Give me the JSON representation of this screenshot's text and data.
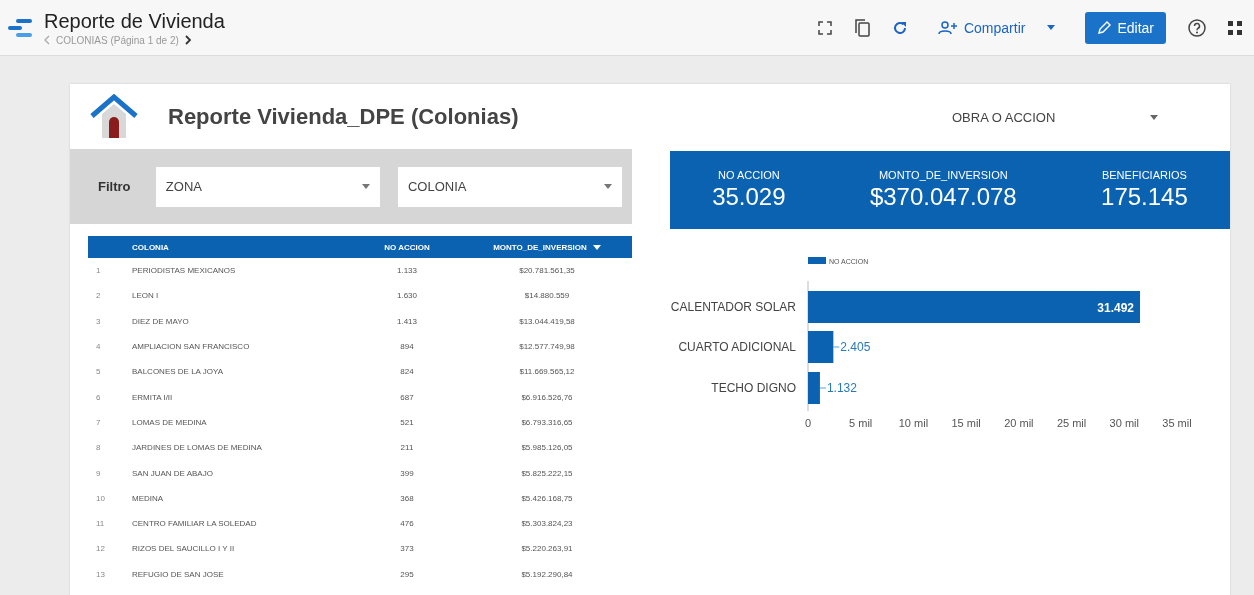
{
  "header": {
    "title": "Reporte de Vivienda",
    "page_nav": "COLONIAS (Página 1 de 2)",
    "share_button": "Compartir",
    "edit_button": "Editar"
  },
  "report": {
    "title": "Reporte Vivienda_DPE (Colonias)",
    "filter": {
      "label": "Filtro",
      "dropdowns": [
        "ZONA",
        "COLONIA"
      ]
    },
    "action_dropdown": "OBRA O ACCION",
    "kpis": [
      {
        "label": "NO ACCION",
        "value": "35.029"
      },
      {
        "label": "MONTO_DE_INVERSION",
        "value": "$370.047.078"
      },
      {
        "label": "BENEFICIARIOS",
        "value": "175.145"
      }
    ],
    "table": {
      "columns": [
        "COLONIA",
        "NO ACCION",
        "MONTO_DE_INVERSION"
      ],
      "rows": [
        {
          "index": "1",
          "colonia": "PERIODISTAS MEXICANOS",
          "no_accion": "1.133",
          "monto": "$20.781.561,35"
        },
        {
          "index": "2",
          "colonia": "LEON I",
          "no_accion": "1.630",
          "monto": "$14.880.559"
        },
        {
          "index": "3",
          "colonia": "DIEZ DE MAYO",
          "no_accion": "1.413",
          "monto": "$13.044.419,58"
        },
        {
          "index": "4",
          "colonia": "AMPLIACION SAN FRANCISCO",
          "no_accion": "894",
          "monto": "$12.577.749,98"
        },
        {
          "index": "5",
          "colonia": "BALCONES DE LA JOYA",
          "no_accion": "824",
          "monto": "$11.669.565,12"
        },
        {
          "index": "6",
          "colonia": "ERMITA I/II",
          "no_accion": "687",
          "monto": "$6.916.526,76"
        },
        {
          "index": "7",
          "colonia": "LOMAS DE MEDINA",
          "no_accion": "521",
          "monto": "$6.793.316,65"
        },
        {
          "index": "8",
          "colonia": "JARDINES DE LOMAS DE MEDINA",
          "no_accion": "211",
          "monto": "$5.985.126,05"
        },
        {
          "index": "9",
          "colonia": "SAN JUAN DE ABAJO",
          "no_accion": "399",
          "monto": "$5.825.222,15"
        },
        {
          "index": "10",
          "colonia": "MEDINA",
          "no_accion": "368",
          "monto": "$5.426.168,75"
        },
        {
          "index": "11",
          "colonia": "CENTRO FAMILIAR LA SOLEDAD",
          "no_accion": "476",
          "monto": "$5.303.824,23"
        },
        {
          "index": "12",
          "colonia": "RIZOS DEL SAUCILLO I Y II",
          "no_accion": "373",
          "monto": "$5.220.263,91"
        },
        {
          "index": "13",
          "colonia": "REFUGIO DE SAN JOSE",
          "no_accion": "295",
          "monto": "$5.192.290,84"
        }
      ]
    },
    "chart_data": {
      "type": "bar",
      "orientation": "horizontal",
      "categories": [
        "CALENTADOR SOLAR",
        "CUARTO ADICIONAL",
        "TECHO DIGNO"
      ],
      "series": [
        {
          "name": "NO ACCION",
          "color": "#0b62b0",
          "values": [
            31.492,
            2.405,
            1.132
          ]
        }
      ],
      "xlim": [
        0,
        35
      ],
      "xticks": [
        {
          "value": 0,
          "label": "0"
        },
        {
          "value": 5,
          "label": "5 mil"
        },
        {
          "value": 10,
          "label": "10 mil"
        },
        {
          "value": 15,
          "label": "15 mil"
        },
        {
          "value": 20,
          "label": "20 mil"
        },
        {
          "value": 25,
          "label": "25 mil"
        },
        {
          "value": 30,
          "label": "30 mil"
        },
        {
          "value": 35,
          "label": "35 mil"
        }
      ],
      "value_labels": [
        "31.492",
        "2.405",
        "1.132"
      ]
    }
  }
}
